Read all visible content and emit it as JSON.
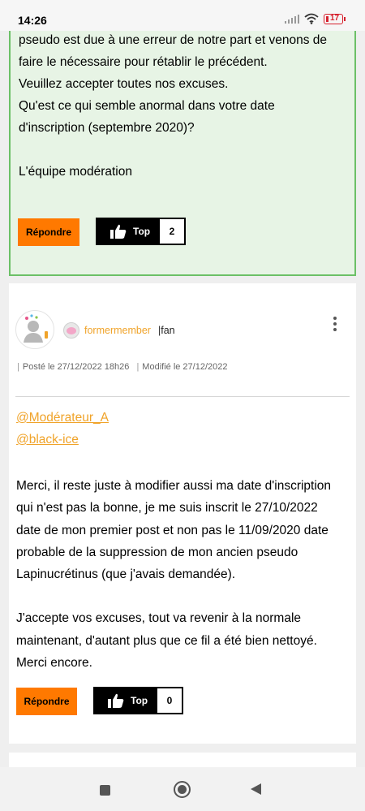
{
  "status_bar": {
    "time": "14:26",
    "battery": "17"
  },
  "post1": {
    "lines": [
      "pseudo est due à une erreur de notre part et venons de",
      "faire le nécessaire pour rétablir le précédent.",
      "Veuillez accepter toutes nos excuses.",
      "Qu'est ce qui semble anormal dans votre date",
      "d'inscription (septembre 2020)?",
      "",
      "L'équipe modération"
    ],
    "reply_label": "Répondre",
    "top_label": "Top",
    "top_count": "2",
    "border_color": "#6cc067",
    "background": "#e7f4e5"
  },
  "post2": {
    "username": "formermember",
    "rank": "|fan",
    "posted": "Posté le 27/12/2022 18h26",
    "modified": "Modifié le 27/12/2022",
    "mentions": [
      "@Modérateur_A",
      "@black-ice"
    ],
    "paragraphs": [
      [
        "Merci, il reste juste à modifier aussi ma date d'inscription",
        "qui n'est pas la bonne, je me suis inscrit le 27/10/2022",
        "date de mon premier post et non pas le 11/09/2020 date",
        "probable de la suppression de mon ancien pseudo",
        "Lapinucrétinus (que j'avais demandée)."
      ],
      [
        "J'accepte vos excuses, tout va revenir à la normale",
        "maintenant, d'autant plus que ce fil a été bien nettoyé.",
        "Merci encore."
      ]
    ],
    "reply_label": "Répondre",
    "top_label": "Top",
    "top_count": "0"
  },
  "colors": {
    "accent": "#ff7900",
    "username": "#f0a329",
    "battery_low": "#d6202d"
  }
}
